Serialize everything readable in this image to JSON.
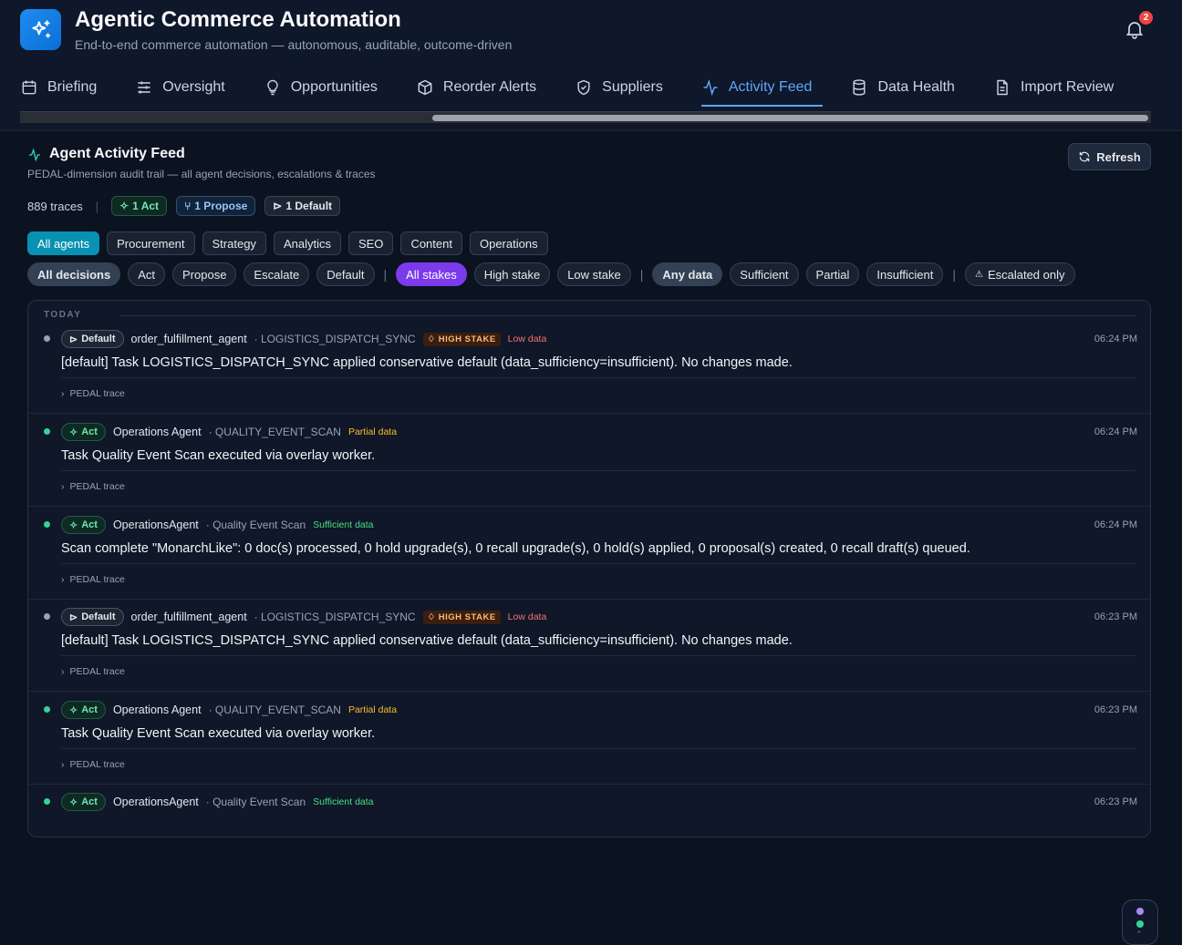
{
  "app": {
    "title": "Agentic Commerce Automation",
    "subtitle": "End-to-end commerce automation — autonomous, auditable, outcome-driven",
    "notification_count": "2"
  },
  "tabs": [
    {
      "label": "Briefing",
      "icon": "calendar-icon"
    },
    {
      "label": "Oversight",
      "icon": "sliders-icon"
    },
    {
      "label": "Opportunities",
      "icon": "lightbulb-icon"
    },
    {
      "label": "Reorder Alerts",
      "icon": "box-icon"
    },
    {
      "label": "Suppliers",
      "icon": "shield-icon"
    },
    {
      "label": "Activity Feed",
      "icon": "activity-icon",
      "active": true
    },
    {
      "label": "Data Health",
      "icon": "database-icon"
    },
    {
      "label": "Import Review",
      "icon": "document-icon"
    }
  ],
  "section": {
    "title": "Agent Activity Feed",
    "subtitle": "PEDAL-dimension audit trail — all agent decisions, escalations & traces",
    "refresh_label": "Refresh",
    "trace_count": "889 traces",
    "chips": {
      "act": "1 Act",
      "propose": "1 Propose",
      "default": "1 Default"
    }
  },
  "agent_filters": [
    "All agents",
    "Procurement",
    "Strategy",
    "Analytics",
    "SEO",
    "Content",
    "Operations"
  ],
  "decision_filters": [
    "All decisions",
    "Act",
    "Propose",
    "Escalate",
    "Default"
  ],
  "stake_filters": [
    "All stakes",
    "High stake",
    "Low stake"
  ],
  "data_filters": [
    "Any data",
    "Sufficient",
    "Partial",
    "Insufficient"
  ],
  "escalated_label": "Escalated only",
  "feed": {
    "group_label": "TODAY",
    "trace_label": "PEDAL trace",
    "entries": [
      {
        "decision": "Default",
        "agent": "order_fulfillment_agent",
        "task": "· LOGISTICS_DISPATCH_SYNC",
        "stake": "HIGH STAKE",
        "data": "Low data",
        "time": "06:24 PM",
        "message": "[default] Task LOGISTICS_DISPATCH_SYNC applied conservative default (data_sufficiency=insufficient). No changes made."
      },
      {
        "decision": "Act",
        "agent": "Operations Agent",
        "task": "· QUALITY_EVENT_SCAN",
        "stake": "",
        "data": "Partial data",
        "time": "06:24 PM",
        "message": "Task Quality Event Scan executed via overlay worker."
      },
      {
        "decision": "Act",
        "agent": "OperationsAgent",
        "task": "· Quality Event Scan",
        "stake": "",
        "data": "Sufficient data",
        "time": "06:24 PM",
        "message": "Scan complete \"MonarchLike\": 0 doc(s) processed, 0 hold upgrade(s), 0 recall upgrade(s), 0 hold(s) applied, 0 proposal(s) created, 0 recall draft(s) queued."
      },
      {
        "decision": "Default",
        "agent": "order_fulfillment_agent",
        "task": "· LOGISTICS_DISPATCH_SYNC",
        "stake": "HIGH STAKE",
        "data": "Low data",
        "time": "06:23 PM",
        "message": "[default] Task LOGISTICS_DISPATCH_SYNC applied conservative default (data_sufficiency=insufficient). No changes made."
      },
      {
        "decision": "Act",
        "agent": "Operations Agent",
        "task": "· QUALITY_EVENT_SCAN",
        "stake": "",
        "data": "Partial data",
        "time": "06:23 PM",
        "message": "Task Quality Event Scan executed via overlay worker."
      },
      {
        "decision": "Act",
        "agent": "OperationsAgent",
        "task": "· Quality Event Scan",
        "stake": "",
        "data": "Sufficient data",
        "time": "06:23 PM",
        "message": ""
      }
    ]
  },
  "colors": {
    "accent": "#60a5fa",
    "act": "#34d399",
    "default": "#94a3b8",
    "stake_purple": "#7c3aed",
    "agent_cyan": "#0891b2"
  }
}
